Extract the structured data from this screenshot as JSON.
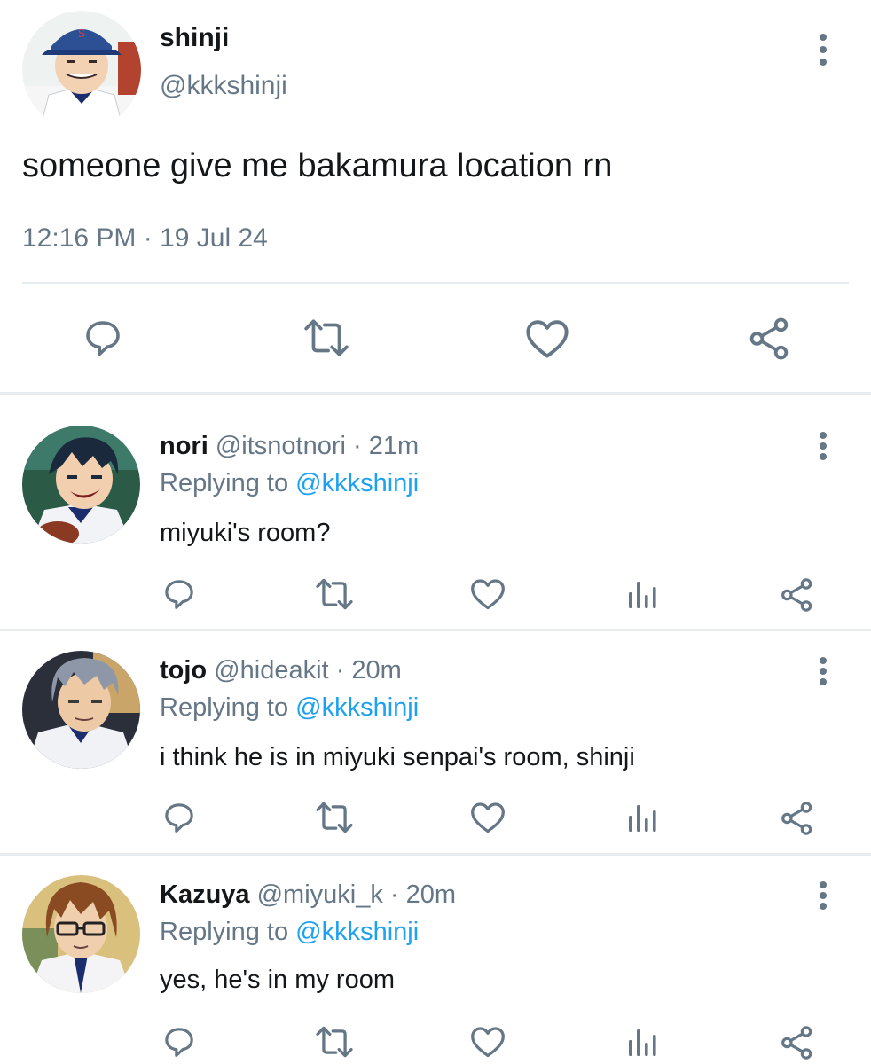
{
  "main": {
    "name": "shinji",
    "handle": "@kkkshinji",
    "text": "someone give me bakamura location rn",
    "timestamp": "12:16 PM · 19 Jul 24"
  },
  "replies": [
    {
      "name": "nori",
      "handle": "@itsnotnori",
      "time": "· 21m",
      "replying_label": "Replying to",
      "replying_to": "@kkkshinji",
      "text": "miyuki's room?"
    },
    {
      "name": "tojo",
      "handle": "@hideakit",
      "time": "· 20m",
      "replying_label": "Replying to",
      "replying_to": "@kkkshinji",
      "text": "i think he is in miyuki senpai's room, shinji"
    },
    {
      "name": "Kazuya",
      "handle": "@miyuki_k",
      "time": "· 20m",
      "replying_label": "Replying to",
      "replying_to": "@kkkshinji",
      "text": "yes, he's in my room"
    }
  ],
  "icons": {
    "reply": "comment-icon",
    "retweet": "retweet-icon",
    "like": "heart-icon",
    "analytics": "analytics-icon",
    "share": "share-icon",
    "more": "more-vertical-icon"
  },
  "colors": {
    "text": "#14171a",
    "secondary": "#657786",
    "mention": "#1da1f2",
    "divider": "#e6ecf0"
  }
}
